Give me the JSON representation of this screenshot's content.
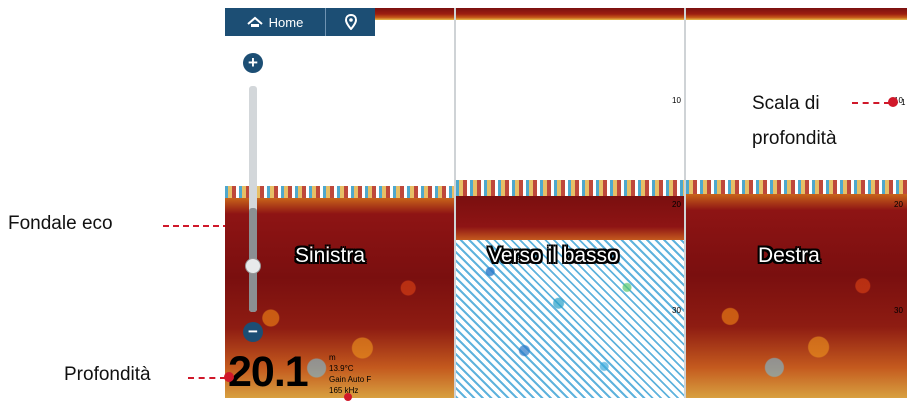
{
  "annotations": {
    "seabed_echo": "Fondale eco",
    "depth": "Profondità",
    "depth_scale_line1": "Scala di",
    "depth_scale_line2": "profondità",
    "scale_tick": "1"
  },
  "toolbar": {
    "home_label": "Home",
    "home_icon": "home-icon",
    "pin_icon": "location-pin-icon"
  },
  "zoom": {
    "plus_label": "+",
    "minus_label": "−",
    "level": 0.25
  },
  "readout": {
    "depth_value": "20.1",
    "unit": "m",
    "temperature": "13.9°C",
    "gain": "Gain Auto F",
    "frequency": "165 kHz"
  },
  "panels": [
    {
      "label": "Sinistra",
      "ticks": [],
      "tick_y": []
    },
    {
      "label": "Verso il basso",
      "ticks": [
        "10",
        "20",
        "30"
      ],
      "tick_y": [
        10,
        20,
        30
      ]
    },
    {
      "label": "Destra",
      "ticks": [
        "10",
        "20",
        "30"
      ],
      "tick_y": [
        10,
        20,
        30
      ]
    }
  ],
  "colors": {
    "toolbar": "#1c4e74",
    "annotation_line": "#d0182a",
    "seabed": "#7a0f0f",
    "water": "#ffffff"
  }
}
